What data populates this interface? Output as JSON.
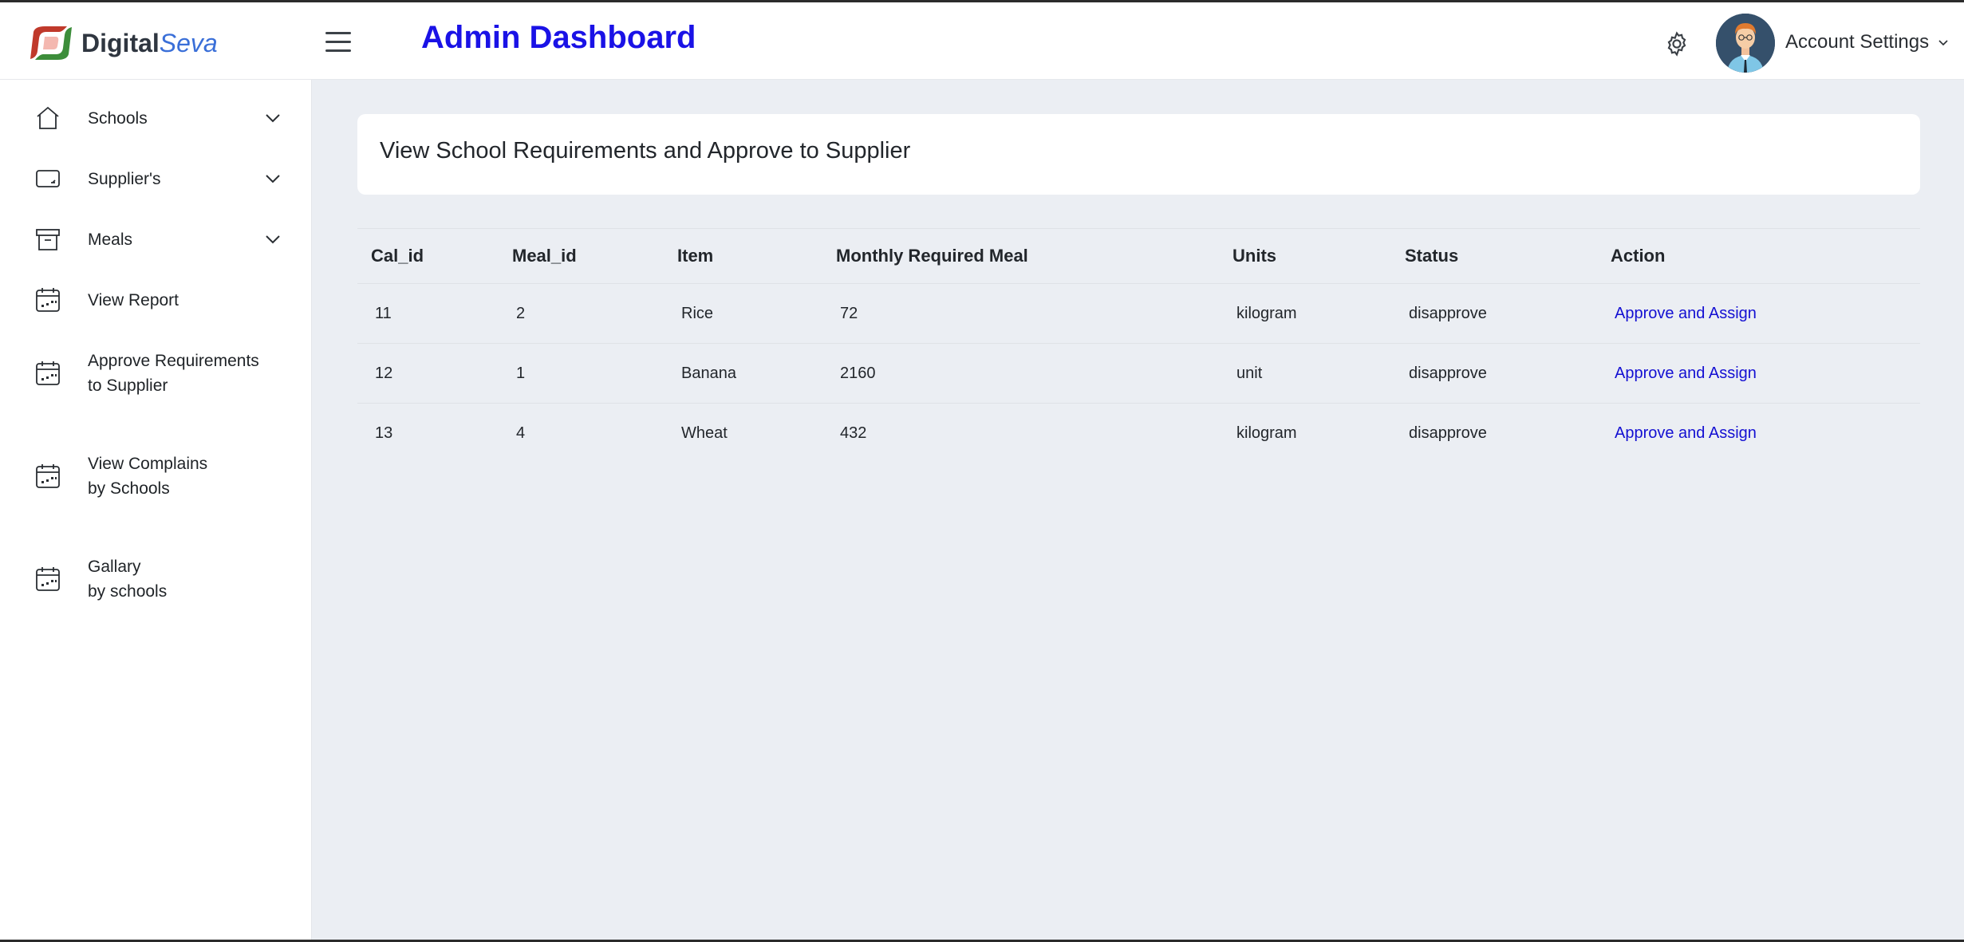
{
  "brand": {
    "logo_bold": "Digital",
    "logo_italic": "Seva",
    "accent": "#1a12e6"
  },
  "header": {
    "title": "Admin Dashboard",
    "account_label": "Account Settings"
  },
  "sidebar": {
    "items": [
      {
        "label": "Schools",
        "icon": "home-icon",
        "expandable": true
      },
      {
        "label": "Supplier's",
        "icon": "tablet-icon",
        "expandable": true
      },
      {
        "label": "Meals",
        "icon": "archive-icon",
        "expandable": true
      },
      {
        "label": "View Report",
        "icon": "calendar-icon",
        "expandable": false
      },
      {
        "label_line1": "Approve Requirements",
        "label_line2": "to Supplier",
        "icon": "calendar-icon",
        "expandable": false
      },
      {
        "label_line1": "View Complains",
        "label_line2": "by Schools",
        "icon": "calendar-icon",
        "expandable": false
      },
      {
        "label_line1": "Gallary",
        "label_line2": "by schools",
        "icon": "calendar-icon",
        "expandable": false
      }
    ]
  },
  "main": {
    "card_title": "View School Requirements and Approve to Supplier",
    "table": {
      "headers": [
        "Cal_id",
        "Meal_id",
        "Item",
        "Monthly Required Meal",
        "Units",
        "Status",
        "Action"
      ],
      "rows": [
        [
          "11",
          "2",
          "Rice",
          "72",
          "kilogram",
          "disapprove",
          "Approve and Assign"
        ],
        [
          "12",
          "1",
          "Banana",
          "2160",
          "unit",
          "disapprove",
          "Approve and Assign"
        ],
        [
          "13",
          "4",
          "Wheat",
          "432",
          "kilogram",
          "disapprove",
          "Approve and Assign"
        ]
      ]
    }
  }
}
